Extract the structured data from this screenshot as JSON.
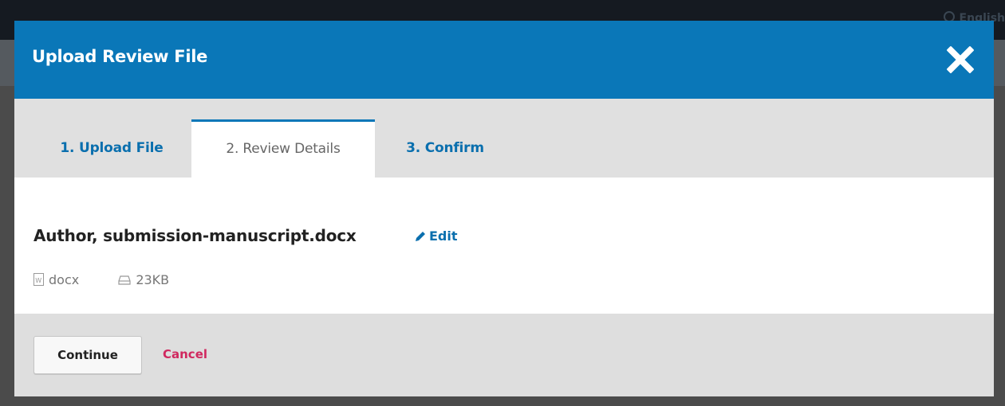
{
  "backdrop": {
    "language_label": "English"
  },
  "modal": {
    "title": "Upload Review File",
    "close_icon": "close-icon"
  },
  "tabs": [
    {
      "label": "1. Upload File",
      "active": false
    },
    {
      "label": "2. Review Details",
      "active": true
    },
    {
      "label": "3. Confirm",
      "active": false
    }
  ],
  "file": {
    "name": "Author, submission-manuscript.docx",
    "edit_label": "Edit",
    "type": "docx",
    "size": "23KB"
  },
  "footer": {
    "continue_label": "Continue",
    "cancel_label": "Cancel"
  },
  "colors": {
    "header": "#0a77b8",
    "link": "#0a6fae",
    "cancel": "#d0285f",
    "tab_bar": "#e0e0e0",
    "footer": "#dedede"
  }
}
